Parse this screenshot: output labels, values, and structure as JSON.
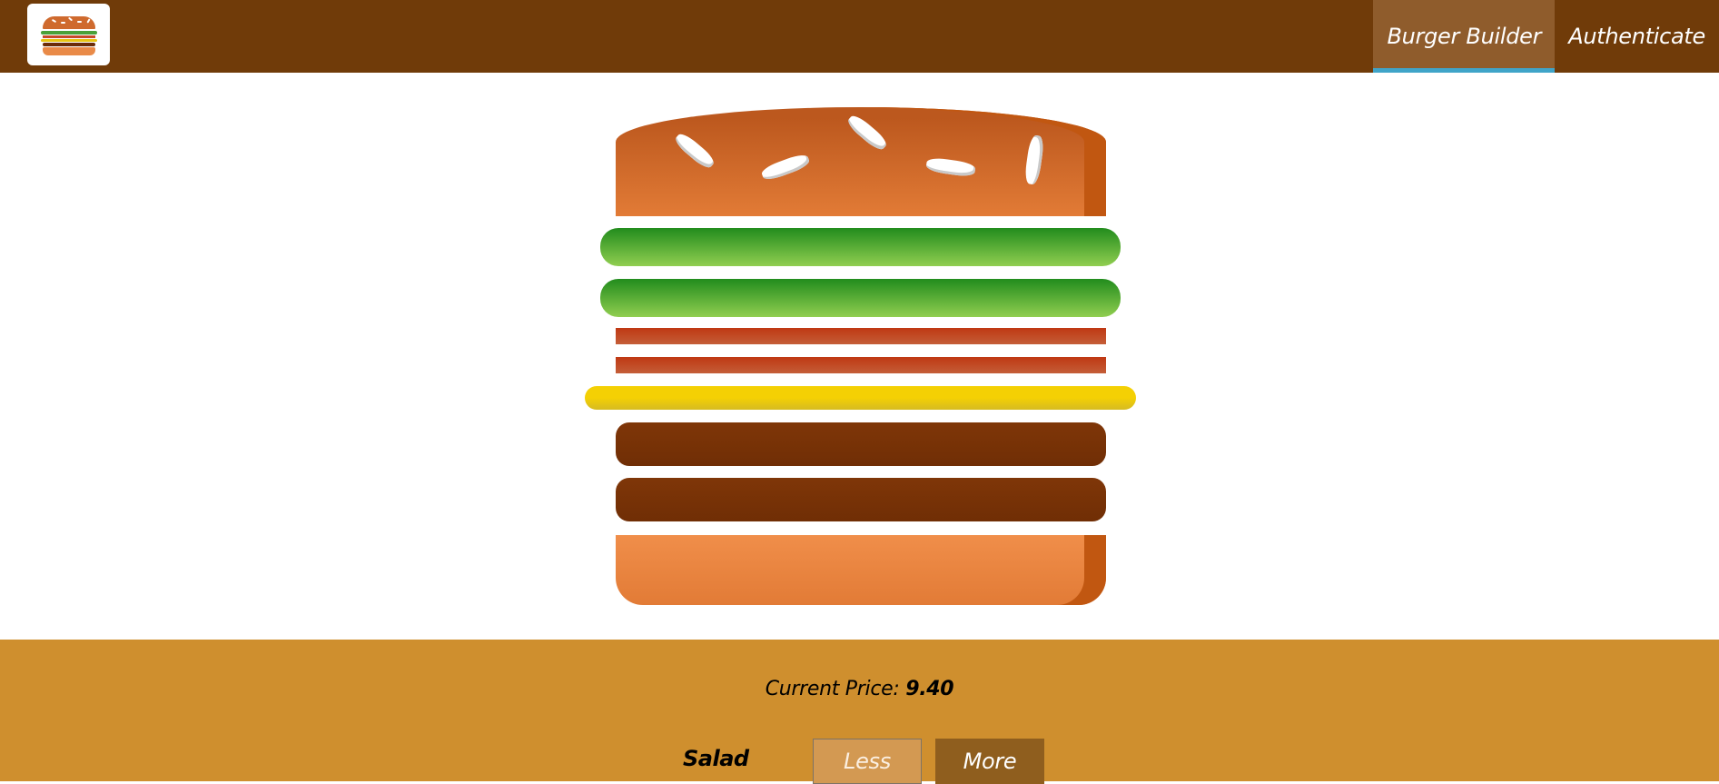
{
  "toolbar": {
    "logo_icon": "burger-logo-icon",
    "nav": [
      {
        "label": "Burger Builder",
        "active": true
      },
      {
        "label": "Authenticate",
        "active": false
      }
    ]
  },
  "burger": {
    "layers_top_to_bottom": [
      "bread-top",
      "salad",
      "salad",
      "bacon",
      "bacon",
      "cheese",
      "meat",
      "meat",
      "bread-bottom"
    ]
  },
  "build_controls": {
    "price_label": "Current Price:",
    "price_value": "9.40",
    "controls": [
      {
        "label": "Salad",
        "less_label": "Less",
        "more_label": "More"
      }
    ]
  },
  "colors": {
    "toolbar_bg": "#703b09",
    "nav_active_bg": "#8f5c2c",
    "nav_active_border": "#40a4c8",
    "controls_bg": "#cf8f2e",
    "less_button_bg": "#d39952",
    "more_button_bg": "#8f5e1e"
  }
}
